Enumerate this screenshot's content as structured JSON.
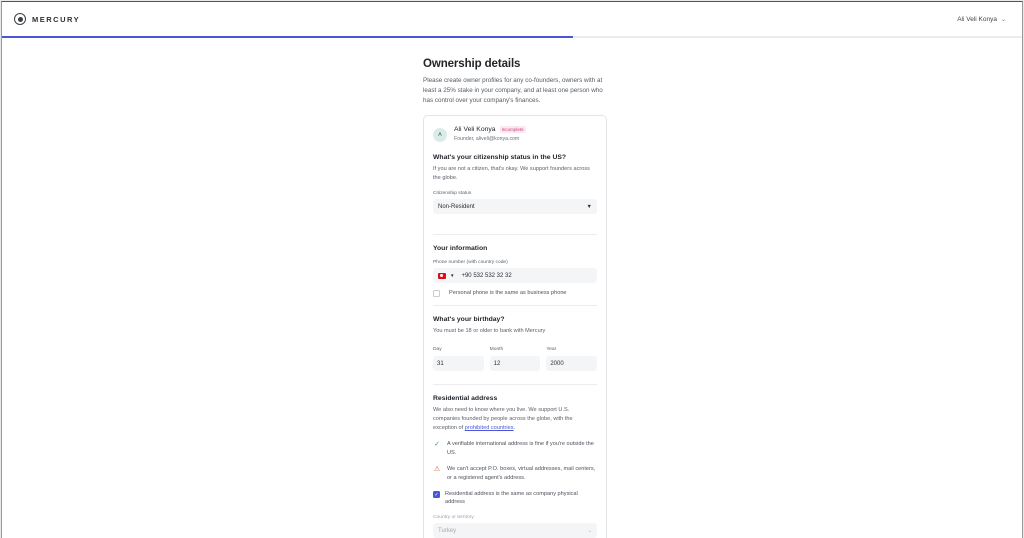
{
  "topbar": {
    "brand": "MERCURY",
    "user_name": "Ali Veli Konya",
    "user_caret": "⌄"
  },
  "progress": {
    "fraction": 0.56,
    "color": "#4a56d6"
  },
  "page": {
    "title": "Ownership details",
    "description": "Please create owner profiles for any co-founders, owners with at least a 25% stake in your company, and at least one person who has control over your company's finances."
  },
  "owner": {
    "avatar_initial": "A",
    "name": "Ali Veli Konya",
    "badge": "Incomplete",
    "subtitle": "Founder, aliveli@konya.com"
  },
  "citizenship": {
    "title": "What's your citizenship status in the US?",
    "description": "If you are not a citizen, that's okay. We support founders across the globe.",
    "field_label": "Citizenship status",
    "value": "Non-Resident"
  },
  "your_info": {
    "title": "Your information",
    "phone_label": "Phone number (with country code)",
    "phone_value": "+90 532 532 32 32",
    "same_phone_label": "Personal phone is the same as business phone"
  },
  "birthday": {
    "title": "What's your birthday?",
    "description": "You must be 18 or older to bank with Mercury",
    "day_label": "Day",
    "day_value": "31",
    "month_label": "Month",
    "month_value": "12",
    "year_label": "Year",
    "year_value": "2000"
  },
  "address": {
    "title": "Residential address",
    "description_prefix": "We also need to know where you live. We support U.S. companies founded by people across the globe, with the exception of ",
    "link_text": "prohibited countries",
    "description_suffix": ".",
    "note_ok": "A verifiable international address is fine if you're outside the US.",
    "note_warn": "We can't accept P.O. boxes, virtual addresses, mail centers, or a registered agent's address.",
    "same_address_label": "Residential address is the same as company physical address",
    "country_label": "Country or territory",
    "country_value": "Turkey"
  }
}
